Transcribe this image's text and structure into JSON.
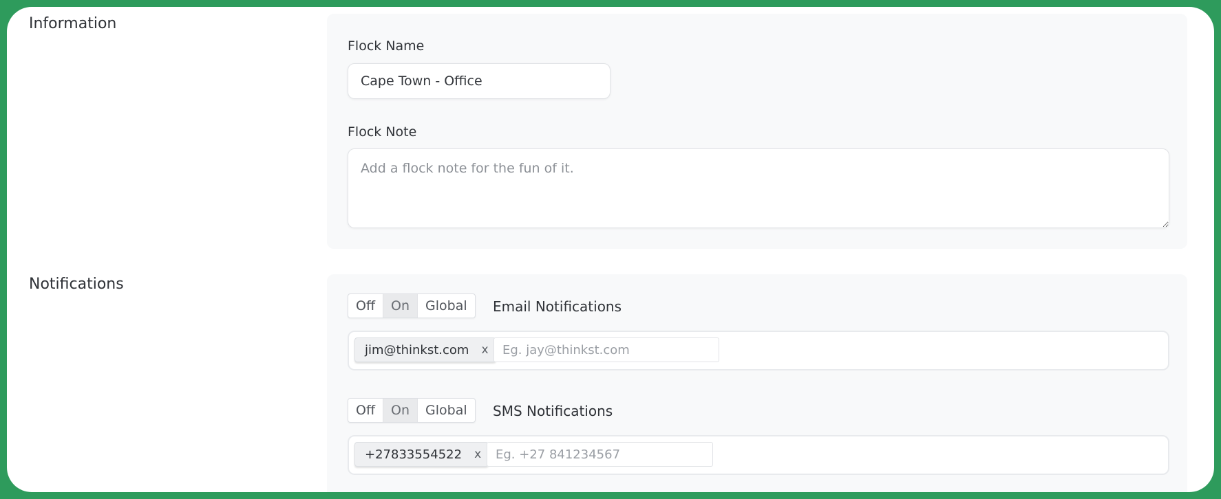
{
  "information": {
    "section_title": "Information",
    "flock_name": {
      "label": "Flock Name",
      "value": "Cape Town - Office"
    },
    "flock_note": {
      "label": "Flock Note",
      "placeholder": "Add a flock note for the fun of it."
    }
  },
  "notifications": {
    "section_title": "Notifications",
    "email": {
      "toggle": {
        "options": [
          "Off",
          "On",
          "Global"
        ],
        "selected": "On"
      },
      "label": "Email Notifications",
      "tags": [
        "jim@thinkst.com"
      ],
      "input_placeholder": "Eg. jay@thinkst.com"
    },
    "sms": {
      "toggle": {
        "options": [
          "Off",
          "On",
          "Global"
        ],
        "selected": "On"
      },
      "label": "SMS Notifications",
      "tags": [
        "+27833554522"
      ],
      "input_placeholder": "Eg. +27 841234567"
    },
    "remove_glyph": "x"
  },
  "colors": {
    "frame_border": "#2e9b5c",
    "panel_bg": "#f8f9fa",
    "active_toggle_bg": "#e9eaec"
  }
}
